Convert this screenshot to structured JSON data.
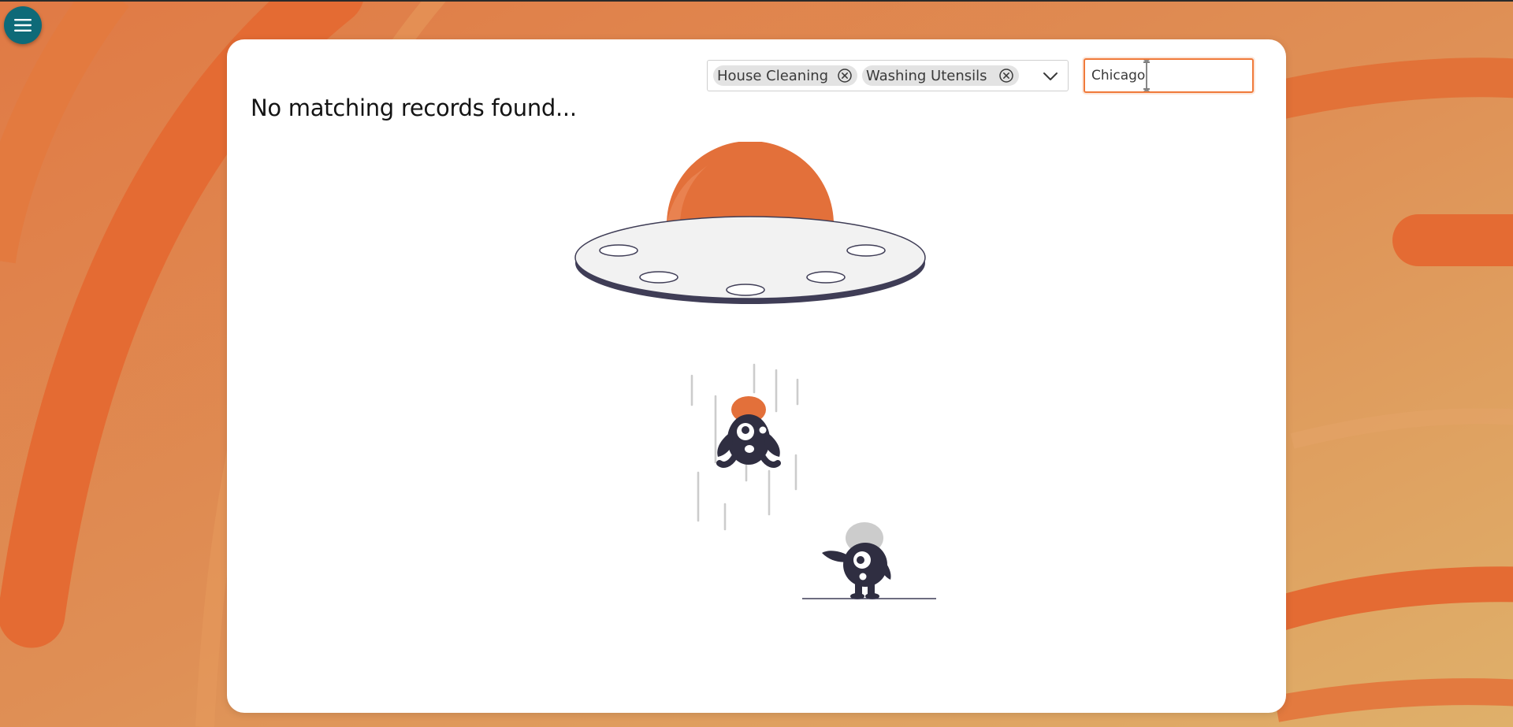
{
  "colors": {
    "accent": "#e3703a",
    "menu_button": "#0e6a78",
    "character": "#2f2e41",
    "page_background": "#de8a50"
  },
  "menu": {
    "icon": "hamburger-menu-icon"
  },
  "filters": {
    "selected": [
      {
        "label": "House Cleaning",
        "remove_icon": "circle-x-icon"
      },
      {
        "label": "Washing Utensils",
        "remove_icon": "circle-x-icon"
      }
    ],
    "toggle_icon": "chevron-down-icon"
  },
  "search": {
    "value": "Chicago"
  },
  "results": {
    "empty_message": "No matching records found..."
  },
  "illustration": {
    "name": "ufo-abduction-illustration"
  }
}
